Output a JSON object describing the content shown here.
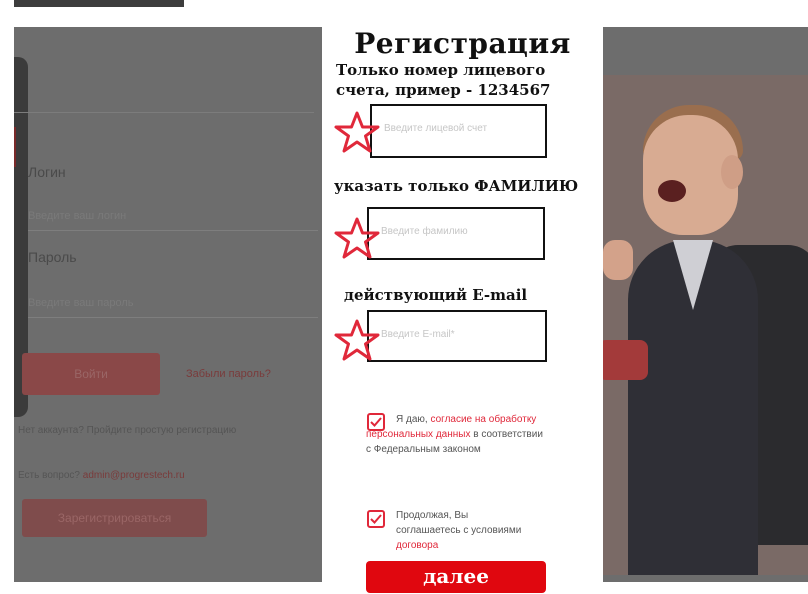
{
  "background": {
    "login_label": "Логин",
    "login_placeholder": "Введите ваш логин",
    "password_label": "Пароль",
    "password_placeholder": "Введите ваш пароль",
    "login_button": "Войти",
    "forgot_password": "Забыли пароль?",
    "no_account_text": "Нет аккаунта? Пройдите простую регистрацию",
    "question_prefix": "Есть вопрос?",
    "question_email": "admin@progrestech.ru",
    "register_button": "Зарегистрироваться"
  },
  "modal": {
    "title": "Регистрация",
    "account_note": "Только номер лицевого счета, пример - 1234567",
    "account_placeholder": "Введите лицевой счет",
    "surname_note": "указать только ФАМИЛИЮ",
    "surname_placeholder": "Введите фамилию",
    "email_note": "действующий E-mail",
    "email_placeholder": "Введите E-mail*",
    "consent_prefix": "Я даю,",
    "consent_link": "согласие на обработку персональных данных",
    "consent_suffix": "в соответствии с Федеральным законом",
    "terms_prefix": "Продолжая, Вы соглашаетесь с условиями",
    "terms_link": "договора",
    "next_button": "далее"
  },
  "colors": {
    "accent_red": "#e0070f",
    "star_red": "#e0283a",
    "overlay_gray": "#6d6d6d"
  },
  "icons": [
    "star-icon",
    "checkmark-icon"
  ]
}
